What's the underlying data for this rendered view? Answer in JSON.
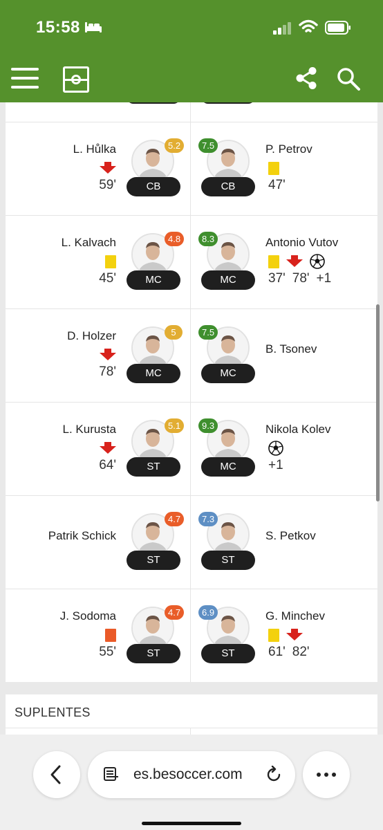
{
  "status_bar": {
    "time": "15:58"
  },
  "browser": {
    "url": "es.besoccer.com"
  },
  "colors": {
    "header_green": "#55912c",
    "rating_yellow": "#e2ad32",
    "rating_orange": "#e95d29",
    "rating_green": "#3f8f2e",
    "rating_blue": "#5e8fc4",
    "yellow_card": "#f3d10e",
    "red_card": "#ea5a28",
    "sub_out_arrow": "#d8221c"
  },
  "section_subs": "SUPLENTES",
  "rows": [
    {
      "left": {
        "name": "L. Hůlka",
        "rating": "5.2",
        "rating_color": "#e2ad32",
        "position": "CB",
        "events": [
          "sub-out-icon"
        ],
        "minutes": [
          "59'"
        ]
      },
      "right": {
        "name": "P. Petrov",
        "rating": "7.5",
        "rating_color": "#3f8f2e",
        "position": "CB",
        "events": [
          "yellow-card-icon"
        ],
        "minutes": [
          "47'"
        ]
      }
    },
    {
      "left": {
        "name": "L. Kalvach",
        "rating": "4.8",
        "rating_color": "#e95d29",
        "position": "MC",
        "events": [
          "yellow-card-icon"
        ],
        "minutes": [
          "45'"
        ]
      },
      "right": {
        "name": "Antonio Vutov",
        "rating": "8.3",
        "rating_color": "#3f8f2e",
        "position": "MC",
        "events": [
          "yellow-card-icon",
          "sub-out-icon",
          "goal-ball-icon"
        ],
        "minutes": [
          "37'",
          "78'",
          "+1"
        ]
      }
    },
    {
      "left": {
        "name": "D. Holzer",
        "rating": "5",
        "rating_color": "#e2ad32",
        "position": "MC",
        "events": [
          "sub-out-icon"
        ],
        "minutes": [
          "78'"
        ]
      },
      "right": {
        "name": "B. Tsonev",
        "rating": "7.5",
        "rating_color": "#3f8f2e",
        "position": "MC",
        "events": [],
        "minutes": []
      }
    },
    {
      "left": {
        "name": "L. Kurusta",
        "rating": "5.1",
        "rating_color": "#e2ad32",
        "position": "ST",
        "events": [
          "sub-out-icon"
        ],
        "minutes": [
          "64'"
        ]
      },
      "right": {
        "name": "Nikola Kolev",
        "rating": "9.3",
        "rating_color": "#3f8f2e",
        "position": "MC",
        "events": [
          "goal-ball-icon"
        ],
        "minutes": [
          "+1"
        ]
      }
    },
    {
      "left": {
        "name": "Patrik Schick",
        "rating": "4.7",
        "rating_color": "#e95d29",
        "position": "ST",
        "events": [],
        "minutes": []
      },
      "right": {
        "name": "S. Petkov",
        "rating": "7.3",
        "rating_color": "#5e8fc4",
        "position": "ST",
        "events": [],
        "minutes": []
      }
    },
    {
      "left": {
        "name": "J. Sodoma",
        "rating": "4.7",
        "rating_color": "#e95d29",
        "position": "ST",
        "events": [
          "red-card-icon"
        ],
        "minutes": [
          "55'"
        ]
      },
      "right": {
        "name": "G. Minchev",
        "rating": "6.9",
        "rating_color": "#5e8fc4",
        "position": "ST",
        "events": [
          "yellow-card-icon",
          "sub-out-icon"
        ],
        "minutes": [
          "61'",
          "82'"
        ]
      }
    }
  ]
}
